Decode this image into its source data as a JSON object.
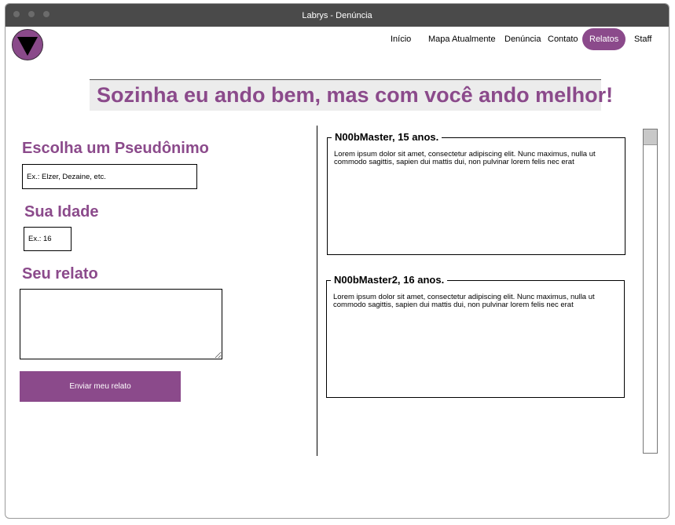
{
  "window": {
    "title": "Labrys - Denúncia"
  },
  "nav": {
    "items": [
      {
        "label": "Início"
      },
      {
        "label": "Mapa Atualmente"
      },
      {
        "label": "Denúncia"
      },
      {
        "label": "Contato"
      },
      {
        "label": "Relatos",
        "active": true
      },
      {
        "label": "Staff"
      }
    ]
  },
  "banner": {
    "text": "Sozinha eu ando bem, mas com você ando melhor!"
  },
  "form": {
    "pseudonym_label": "Escolha um Pseudônimo",
    "pseudonym_placeholder": "Ex.: Elzer, Dezaine, etc.",
    "age_label": "Sua Idade",
    "age_placeholder": "Ex.: 16",
    "report_label": "Seu relato",
    "report_value": "",
    "submit_label": "Enviar meu relato"
  },
  "reports": [
    {
      "title": "N00bMaster, 15 anos.",
      "body": "Lorem ipsum dolor sit amet, consectetur adipiscing elit. Nunc maximus, nulla ut commodo sagittis, sapien dui mattis dui, non pulvinar lorem felis nec erat"
    },
    {
      "title": "N00bMaster2, 16 anos.",
      "body": "Lorem ipsum dolor sit amet, consectetur adipiscing elit. Nunc maximus, nulla ut commodo sagittis, sapien dui mattis dui, non pulvinar lorem felis nec erat"
    }
  ],
  "colors": {
    "accent": "#8b4a8b",
    "titlebar": "#4a4a4a",
    "banner_bg": "#ececec"
  }
}
